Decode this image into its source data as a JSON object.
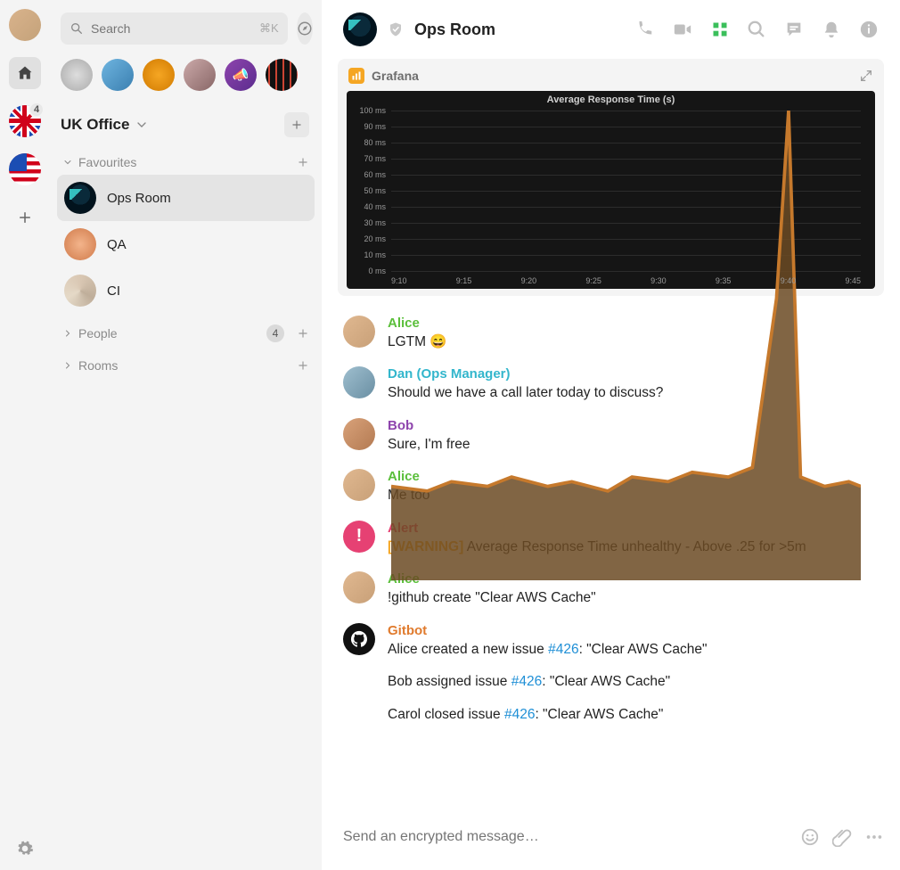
{
  "rail": {
    "uk_badge": "4"
  },
  "search": {
    "placeholder": "Search",
    "shortcut": "⌘K"
  },
  "space": {
    "name": "UK Office"
  },
  "sections": {
    "favourites": {
      "label": "Favourites",
      "rooms": [
        {
          "name": "Ops Room"
        },
        {
          "name": "QA"
        },
        {
          "name": "CI"
        }
      ]
    },
    "people": {
      "label": "People",
      "count": "4"
    },
    "rooms_section": {
      "label": "Rooms"
    }
  },
  "room_header": {
    "title": "Ops Room"
  },
  "grafana": {
    "source": "Grafana"
  },
  "chart_data": {
    "type": "area",
    "title": "Average Response Time (s)",
    "xlabel": "",
    "ylabel": "",
    "x_ticks": [
      "9:10",
      "9:15",
      "9:20",
      "9:25",
      "9:30",
      "9:35",
      "9:40",
      "9:45"
    ],
    "y_ticks": [
      "0 ms",
      "10 ms",
      "20 ms",
      "30 ms",
      "40 ms",
      "50 ms",
      "60 ms",
      "70 ms",
      "80 ms",
      "90 ms",
      "100 ms"
    ],
    "ylim": [
      0,
      100
    ],
    "xlim": [
      "9:07",
      "9:46"
    ],
    "series": [
      {
        "name": "Average Response Time",
        "color": "#c6792c",
        "x": [
          "9:07",
          "9:10",
          "9:12",
          "9:15",
          "9:17",
          "9:20",
          "9:22",
          "9:25",
          "9:27",
          "9:30",
          "9:32",
          "9:35",
          "9:37",
          "9:39",
          "9:40",
          "9:41",
          "9:43",
          "9:45",
          "9:46"
        ],
        "y": [
          20,
          19,
          21,
          20,
          22,
          20,
          21,
          19,
          22,
          21,
          23,
          22,
          24,
          60,
          100,
          22,
          20,
          21,
          20
        ]
      }
    ]
  },
  "colors": {
    "alice": "#5bbf3b",
    "dan": "#33b6cc",
    "bob": "#8e44ad",
    "alert": "#e64173",
    "gitbot": "#e07b2e",
    "link": "#1f8fd6",
    "warn": "#f5a623"
  },
  "messages": [
    {
      "sender": "Alice",
      "style": "alice",
      "avatar": "alice",
      "text": "LGTM 😄"
    },
    {
      "sender": "Dan (Ops Manager)",
      "style": "dan",
      "avatar": "dan",
      "text": "Should we have a call later today to discuss?"
    },
    {
      "sender": "Bob",
      "style": "bob",
      "avatar": "bob",
      "text": "Sure, I'm free"
    },
    {
      "sender": "Alice",
      "style": "alice",
      "avatar": "alice",
      "text": "Me too"
    },
    {
      "sender": "Alert",
      "style": "alert",
      "avatar": "alert",
      "rich": [
        {
          "warn": "[WARNING]",
          "rest": " Average Response Time unhealthy - Above .25 for >5m"
        }
      ]
    },
    {
      "sender": "Alice",
      "style": "alice",
      "avatar": "alice",
      "text": "!github create \"Clear AWS Cache\""
    },
    {
      "sender": "Gitbot",
      "style": "gitbot",
      "avatar": "gitbot",
      "gitlines": [
        {
          "pre": "Alice created a new issue ",
          "link": "#426",
          "post": ": \"Clear AWS Cache\""
        },
        {
          "pre": "Bob assigned issue ",
          "link": "#426",
          "post": ": \"Clear AWS Cache\""
        },
        {
          "pre": "Carol closed issue ",
          "link": "#426",
          "post": ": \"Clear AWS Cache\""
        }
      ]
    }
  ],
  "composer": {
    "placeholder": "Send an encrypted message…"
  }
}
